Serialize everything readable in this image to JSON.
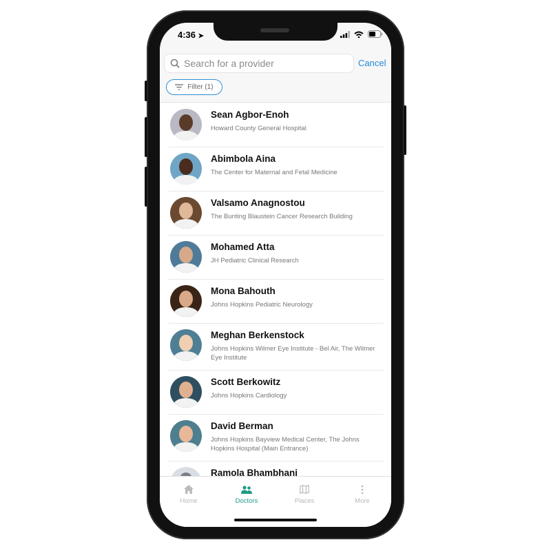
{
  "status_bar": {
    "time": "4:36"
  },
  "search": {
    "placeholder": "Search for a provider",
    "cancel_label": "Cancel",
    "filter_label": "Filter (1)"
  },
  "providers": [
    {
      "name": "Sean Agbor-Enoh",
      "location": "Howard County General Hospital",
      "skin": "#5a3a28",
      "bg": "#b9b9c4"
    },
    {
      "name": "Abimbola Aina",
      "location": "The Center for Maternal and Fetal Medicine",
      "skin": "#4a2c1e",
      "bg": "#6fa6c6"
    },
    {
      "name": "Valsamo Anagnostou",
      "location": "The Bunting Blaustein Cancer Research Building",
      "skin": "#e0b89a",
      "bg": "#6a4a30"
    },
    {
      "name": "Mohamed Atta",
      "location": "JH Pediatric Clinical Research",
      "skin": "#d6a98a",
      "bg": "#4f7b99"
    },
    {
      "name": "Mona Bahouth",
      "location": "Johns Hopkins Pediatric Neurology",
      "skin": "#d9a988",
      "bg": "#3a2418"
    },
    {
      "name": "Meghan Berkenstock",
      "location": "Johns Hopkins Wilmer Eye Institute - Bel Air, The Wilmer Eye Institute",
      "skin": "#f0cfb2",
      "bg": "#4f7f95"
    },
    {
      "name": "Scott Berkowitz",
      "location": "Johns Hopkins Cardiology",
      "skin": "#e0b090",
      "bg": "#2f4f60"
    },
    {
      "name": "David Berman",
      "location": "Johns Hopkins Bayview Medical Center, The Johns Hopkins Hospital (Main Entrance)",
      "skin": "#e8b898",
      "bg": "#4e7f8e"
    },
    {
      "name": "Ramola Bhambhani",
      "location": "",
      "skin": "#7a7e85",
      "bg": "#d9dee4"
    }
  ],
  "tabs": [
    {
      "label": "Home",
      "icon": "home-icon"
    },
    {
      "label": "Doctors",
      "icon": "doctors-icon",
      "active": true
    },
    {
      "label": "Places",
      "icon": "map-icon"
    },
    {
      "label": "More",
      "icon": "more-icon"
    }
  ],
  "colors": {
    "accent": "#1f8ad6",
    "active_tab": "#1f9a86"
  }
}
